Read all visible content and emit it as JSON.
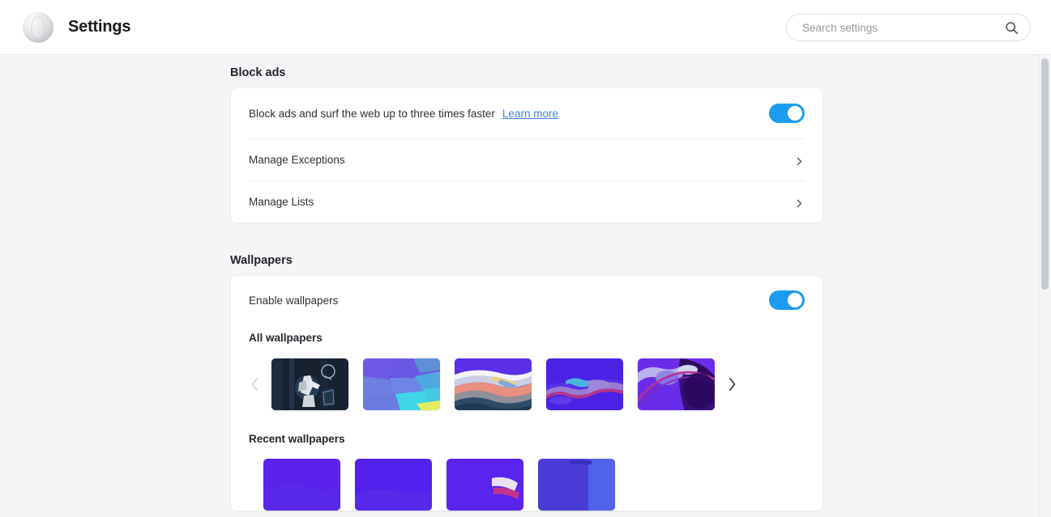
{
  "header": {
    "logo_name": "opera-logo",
    "title": "Settings",
    "search": {
      "placeholder": "Search settings",
      "value": "",
      "icon": "search-icon"
    }
  },
  "sections": [
    {
      "id": "block-ads",
      "title": "Block ads",
      "description": "Block ads and surf the web up to three times faster",
      "link_label": "Learn more",
      "toggle_state": "on",
      "rows": [
        {
          "label": "Manage Exceptions",
          "chevron": "chevron-right-icon"
        },
        {
          "label": "Manage Lists",
          "chevron": "chevron-right-icon"
        }
      ]
    },
    {
      "id": "wallpapers",
      "title": "Wallpapers",
      "enable_label": "Enable wallpapers",
      "toggle_state": "on",
      "all_heading": "All wallpapers",
      "recent_heading": "Recent wallpapers",
      "prev_arrow": "chevron-left-icon",
      "next_arrow": "chevron-right-icon",
      "all_wallpapers": [
        {
          "name": "wallpaper-astronaut-night"
        },
        {
          "name": "wallpaper-purple-cyan-blocks"
        },
        {
          "name": "wallpaper-coral-waves"
        },
        {
          "name": "wallpaper-violet-ridges"
        },
        {
          "name": "wallpaper-violet-swirl"
        }
      ],
      "recent_wallpapers": [
        {
          "name": "recent-wallpaper-violet-1"
        },
        {
          "name": "recent-wallpaper-violet-2"
        },
        {
          "name": "recent-wallpaper-violet-3"
        },
        {
          "name": "recent-wallpaper-violet-4"
        }
      ]
    }
  ],
  "colors": {
    "accent_blue": "#1d9bf0",
    "link_blue": "#3b82f6",
    "page_bg": "#f4f5f7",
    "card_bg": "#ffffff"
  },
  "scrollbar": {
    "name": "vertical-scrollbar"
  }
}
